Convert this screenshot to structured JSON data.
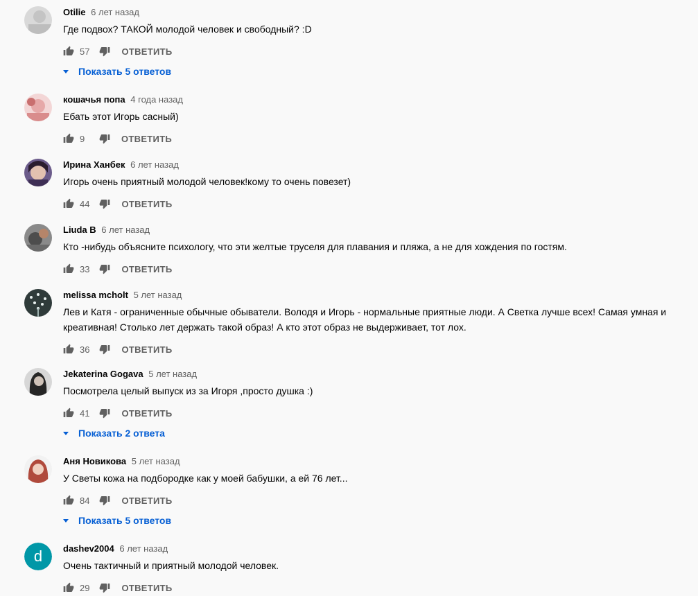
{
  "reply_label": "ОТВЕТИТЬ",
  "comments": [
    {
      "author": "Otilie",
      "time": "6 лет назад",
      "text": "Где подвох? ТАКОЙ молодой человек и свободный? :D",
      "likes": "57",
      "replies_label": "Показать 5 ответов"
    },
    {
      "author": "кошачья попа",
      "time": "4 года назад",
      "text": "Ебать этот Игорь сасный)",
      "likes": "9"
    },
    {
      "author": "Ирина Ханбек",
      "time": "6 лет назад",
      "text": "Игорь очень приятный молодой человек!кому то очень повезет)",
      "likes": "44"
    },
    {
      "author": "Liuda B",
      "time": "6 лет назад",
      "text": "Кто -нибудь объясните психологу, что эти желтые труселя для плавания и пляжа, а не для хождения по гостям.",
      "likes": "33"
    },
    {
      "author": "melissa mcholt",
      "time": "5 лет назад",
      "text": "Лев и Катя - ограниченные обычные обыватели. Володя и Игорь - нормальные приятные люди. А Светка лучше всех! Самая умная и креативная! Столько лет держать такой образ! А кто этот образ не выдерживает, тот лох.",
      "likes": "36"
    },
    {
      "author": "Jekaterina Gogava",
      "time": "5 лет назад",
      "text": "Посмотрела целый выпуск из за Игоря ,просто душка :)",
      "likes": "41",
      "replies_label": "Показать 2 ответа"
    },
    {
      "author": "Аня Новикова",
      "time": "5 лет назад",
      "text": "У Светы кожа на подбородке как у моей бабушки, а ей 76 лет...",
      "likes": "84",
      "replies_label": "Показать 5 ответов"
    },
    {
      "author": "dashev2004",
      "time": "6 лет назад",
      "text": "Очень тактичный и приятный молодой человек.",
      "likes": "29",
      "avatar_letter": "d"
    }
  ]
}
